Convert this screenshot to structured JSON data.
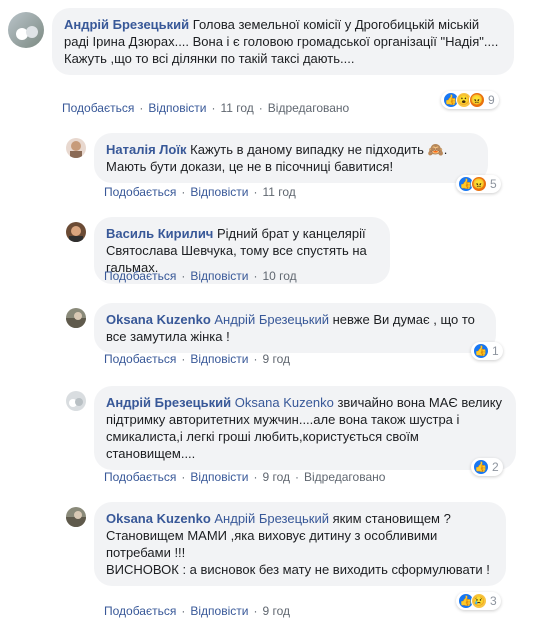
{
  "labels": {
    "like": "Подобається",
    "reply": "Відповісти",
    "edited": "Відредаговано",
    "sep": "·"
  },
  "comments": [
    {
      "author": "Андрій Брезецький",
      "text": "Голова земельної комісії у Дрогобицькій міській раді Ірина Дзюрах.... Вона і є головою громадської організації \"Надія\".... Кажуть ,що то всі ділянки по такій таксі дають....",
      "time": "11 год",
      "reactions": [
        "like-icon",
        "wow-icon",
        "angry-icon"
      ],
      "count": "9"
    },
    {
      "author": "Наталія Лоїк",
      "text": "Кажуть в даному випадку не підходить 🙈. Мають бути докази, це не в пісочниці бавитися!",
      "time": "11 год",
      "reactions": [
        "like-icon",
        "angry-icon"
      ],
      "count": "5"
    },
    {
      "author": "Василь Кирилич",
      "text": "Рідний брат у канцелярії Святослава Шевчука, тому все спустять на гальмах.",
      "time": "10 год"
    },
    {
      "author": "Oksana Kuzenko",
      "mention": "Андрій Брезецький",
      "text": "невже Ви думає , що то все замутила жінка !",
      "time": "9 год",
      "reactions": [
        "like-icon"
      ],
      "count": "1"
    },
    {
      "author": "Андрій Брезецький",
      "mention": "Oksana Kuzenko",
      "text": "звичайно вона МАЄ велику підтримку авторитетних мужчин....але вона також шустра і смикалиста,і легкі гроші любить,користується своїм становищем....",
      "time": "9 год",
      "reactions": [
        "like-icon"
      ],
      "count": "2"
    },
    {
      "author": "Oksana Kuzenko",
      "mention": "Андрій Брезецький",
      "text_lines": [
        "яким становищем ?",
        "Становищем МАМИ ,яка виховує дитину з особливими потребами !!!",
        "ВИСНОВОК : а висновок без мату не виходить сформулювати !"
      ],
      "time": "9 год",
      "reactions": [
        "like-icon",
        "sad-icon"
      ],
      "count": "3"
    }
  ]
}
